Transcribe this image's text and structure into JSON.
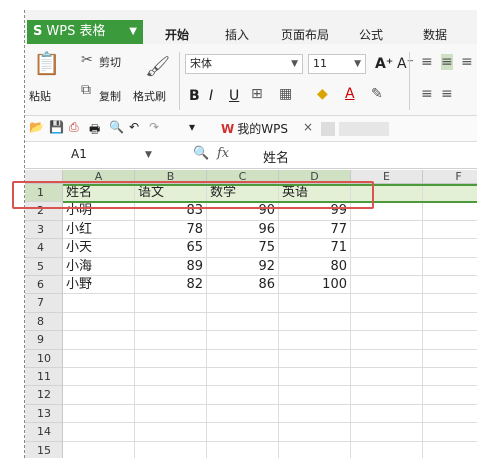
{
  "app": {
    "name": "WPS 表格",
    "logo_glyph": "S",
    "accent": "#3a9a3c"
  },
  "tabs": [
    "开始",
    "插入",
    "页面布局",
    "公式",
    "数据"
  ],
  "ribbon": {
    "cut": "剪切",
    "copy": "复制",
    "paste": "粘贴",
    "format_painter": "格式刷",
    "font_name": "宋体",
    "font_size": "11",
    "bold": "B",
    "italic": "I",
    "underline": "U",
    "font_color": "A"
  },
  "quickbar": {
    "doc_tab": "我的WPS",
    "close": "×"
  },
  "formula_bar": {
    "cell_ref": "A1",
    "fx": "fx",
    "content": "姓名"
  },
  "grid": {
    "columns": [
      "A",
      "B",
      "C",
      "D",
      "E",
      "F"
    ],
    "rows": [
      "1",
      "2",
      "3",
      "4",
      "5",
      "6",
      "7",
      "8",
      "9",
      "10",
      "11",
      "12",
      "13",
      "14",
      "15"
    ],
    "header": [
      "姓名",
      "语文",
      "数学",
      "英语"
    ],
    "data": [
      [
        "小明",
        "83",
        "90",
        "99"
      ],
      [
        "小红",
        "78",
        "96",
        "77"
      ],
      [
        "小天",
        "65",
        "75",
        "71"
      ],
      [
        "小海",
        "89",
        "92",
        "80"
      ],
      [
        "小野",
        "82",
        "86",
        "100"
      ]
    ],
    "selected_row": "1",
    "highlight_color": "#d9534f"
  }
}
